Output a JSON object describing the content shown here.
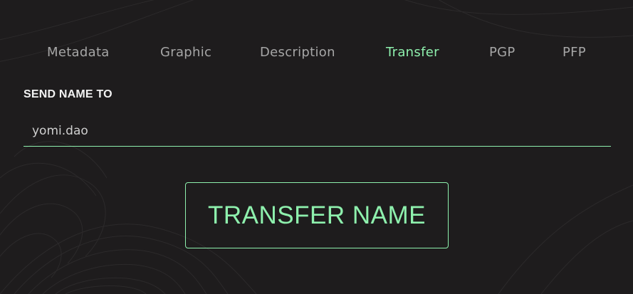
{
  "tabs": [
    {
      "label": "Metadata",
      "active": false
    },
    {
      "label": "Graphic",
      "active": false
    },
    {
      "label": "Description",
      "active": false
    },
    {
      "label": "Transfer",
      "active": true
    },
    {
      "label": "PGP",
      "active": false
    },
    {
      "label": "PFP",
      "active": false
    }
  ],
  "form": {
    "label": "SEND NAME TO",
    "value": "yomi.dao",
    "button_label": "TRANSFER NAME"
  },
  "colors": {
    "background": "#1e1c1d",
    "accent": "#8ef0ad",
    "tab_inactive": "#a6a6a6",
    "label": "#f2f2f2"
  }
}
